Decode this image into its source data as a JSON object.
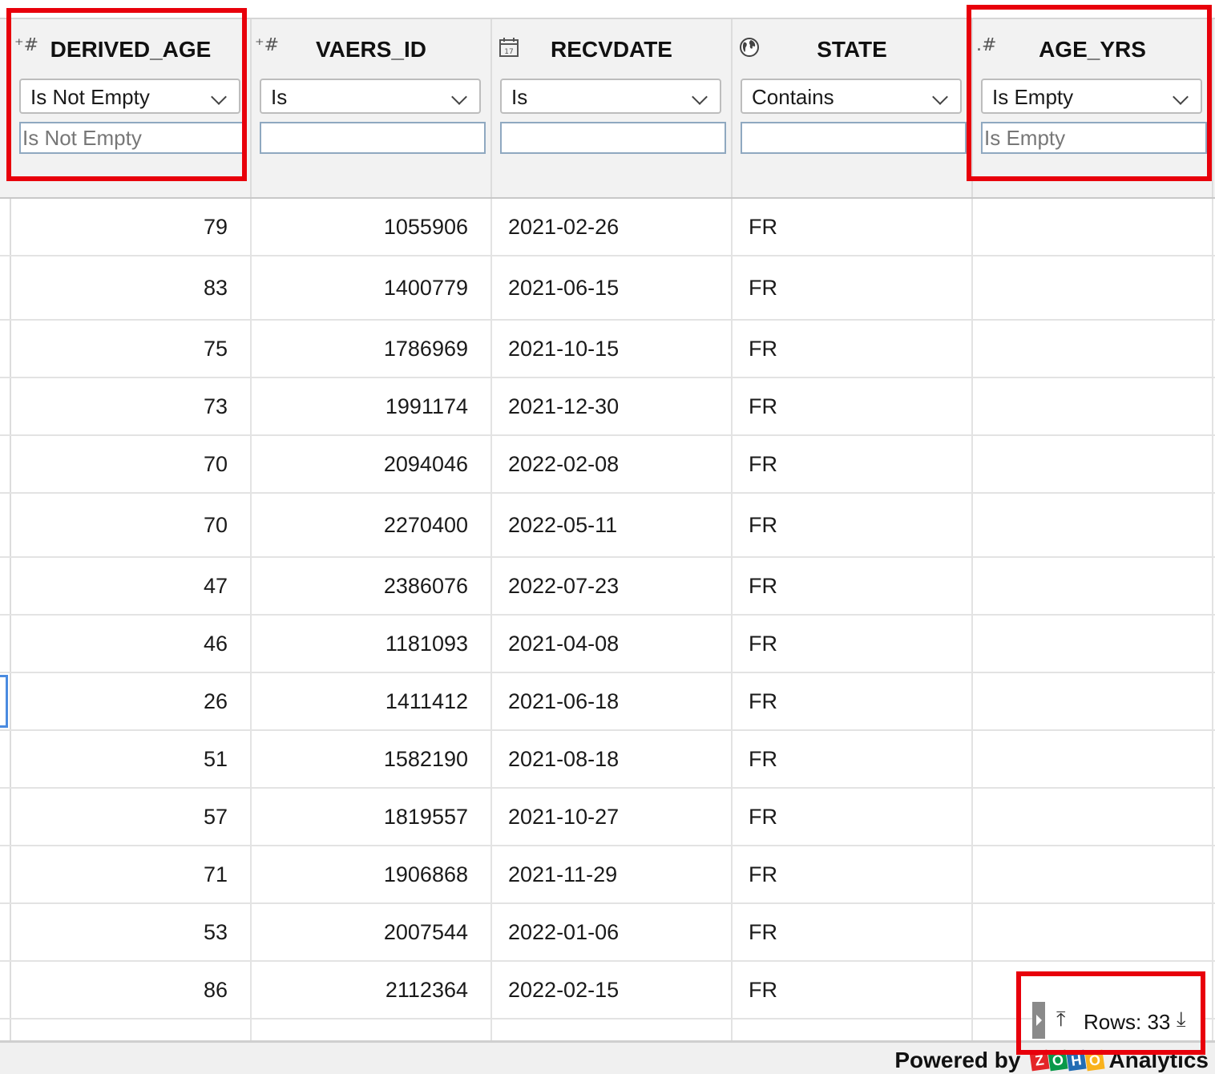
{
  "columns": [
    {
      "key": "derived_age",
      "title": "DERIVED_AGE",
      "type_glyph": "⁺#",
      "operator": "Is Not Empty",
      "filter_placeholder": "Is Not Empty"
    },
    {
      "key": "vaers_id",
      "title": "VAERS_ID",
      "type_glyph": "⁺#",
      "operator": "Is",
      "filter_placeholder": ""
    },
    {
      "key": "recvdate",
      "title": "RECVDATE",
      "type_glyph": "calendar-icon",
      "operator": "Is",
      "filter_placeholder": ""
    },
    {
      "key": "state",
      "title": "STATE",
      "type_glyph": "globe-icon",
      "operator": "Contains",
      "filter_placeholder": ""
    },
    {
      "key": "age_yrs",
      "title": "AGE_YRS",
      "type_glyph": ".#",
      "operator": "Is Empty",
      "filter_placeholder": "Is Empty"
    }
  ],
  "rows": [
    {
      "derived_age": "79",
      "vaers_id": "1055906",
      "recvdate": "2021-02-26",
      "state": "FR",
      "age_yrs": ""
    },
    {
      "derived_age": "83",
      "vaers_id": "1400779",
      "recvdate": "2021-06-15",
      "state": "FR",
      "age_yrs": ""
    },
    {
      "derived_age": "75",
      "vaers_id": "1786969",
      "recvdate": "2021-10-15",
      "state": "FR",
      "age_yrs": ""
    },
    {
      "derived_age": "73",
      "vaers_id": "1991174",
      "recvdate": "2021-12-30",
      "state": "FR",
      "age_yrs": ""
    },
    {
      "derived_age": "70",
      "vaers_id": "2094046",
      "recvdate": "2022-02-08",
      "state": "FR",
      "age_yrs": ""
    },
    {
      "derived_age": "70",
      "vaers_id": "2270400",
      "recvdate": "2022-05-11",
      "state": "FR",
      "age_yrs": ""
    },
    {
      "derived_age": "47",
      "vaers_id": "2386076",
      "recvdate": "2022-07-23",
      "state": "FR",
      "age_yrs": ""
    },
    {
      "derived_age": "46",
      "vaers_id": "1181093",
      "recvdate": "2021-04-08",
      "state": "FR",
      "age_yrs": ""
    },
    {
      "derived_age": "26",
      "vaers_id": "1411412",
      "recvdate": "2021-06-18",
      "state": "FR",
      "age_yrs": ""
    },
    {
      "derived_age": "51",
      "vaers_id": "1582190",
      "recvdate": "2021-08-18",
      "state": "FR",
      "age_yrs": ""
    },
    {
      "derived_age": "57",
      "vaers_id": "1819557",
      "recvdate": "2021-10-27",
      "state": "FR",
      "age_yrs": ""
    },
    {
      "derived_age": "71",
      "vaers_id": "1906868",
      "recvdate": "2021-11-29",
      "state": "FR",
      "age_yrs": ""
    },
    {
      "derived_age": "53",
      "vaers_id": "2007544",
      "recvdate": "2022-01-06",
      "state": "FR",
      "age_yrs": ""
    },
    {
      "derived_age": "86",
      "vaers_id": "2112364",
      "recvdate": "2022-02-15",
      "state": "FR",
      "age_yrs": ""
    }
  ],
  "pager": {
    "rows_label": "Rows: 33"
  },
  "footer": {
    "powered_by": "Powered by",
    "brand_letters": [
      "Z",
      "O",
      "H",
      "O"
    ],
    "product": "Analytics"
  },
  "colors": {
    "highlight": "#e8000b",
    "zoho_z": "#e42527",
    "zoho_o1": "#089949",
    "zoho_h": "#226db4",
    "zoho_o2": "#f9b21d"
  }
}
